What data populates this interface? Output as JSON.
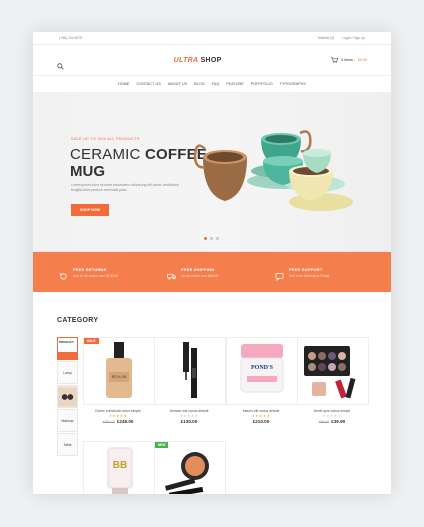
{
  "topbar": {
    "phone": "(+88) 234 5678",
    "wishlist": "Wishlist (0)",
    "login": "Login / Sign up"
  },
  "header": {
    "logo_a": "ULTRA",
    "logo_b": "SHOP",
    "cart_label": "0 items -",
    "cart_total": "£0.00"
  },
  "nav": [
    "HOME",
    "CONTACT US",
    "ABOUT US",
    "BLOG",
    "FAQ",
    "FEATURE",
    "PORTFOLIO",
    "TYPOGRAPHY"
  ],
  "hero": {
    "promo": "SALE UP TO 30% ALL PRODUCTS",
    "title_light": "CERAMIC ",
    "title_bold": "COFFEE",
    "title_line2": "MUG",
    "desc": "Lorem ipsum dolor sit amet consectetur adipiscing elit donec vestibulum fringilla tortor pretium venenatis justo.",
    "button": "SHOP NOW"
  },
  "features": [
    {
      "title": "FREE RETURNS",
      "sub": "Any for all orders over $100.00",
      "icon": "returns-icon"
    },
    {
      "title": "FREE SHIPPING",
      "sub": "On all orders over $45.00",
      "icon": "shipping-icon"
    },
    {
      "title": "FREE SUPPORT",
      "sub": "24/7 from Monday to Friday",
      "icon": "support-icon"
    }
  ],
  "category": {
    "title": "CATEGORY",
    "side": [
      "PRODUCT",
      "Lamp",
      "",
      "Makeup",
      "Table"
    ]
  },
  "products": [
    {
      "name": "Donec sollicitudin dolor simple",
      "old": "£300.00",
      "price": "£249.00",
      "stars": "★★★★★",
      "rated": true,
      "badge": "SALE"
    },
    {
      "name": "Aenean nisl varius default",
      "old": "",
      "price": "£130.00",
      "stars": "★★★★★",
      "rated": false,
      "badge": ""
    },
    {
      "name": "Mauris elit varius default",
      "old": "",
      "price": "£210.00",
      "stars": "★★★★★",
      "rated": true,
      "badge": ""
    },
    {
      "name": "Aenei quis varius simple",
      "old": "£55.00",
      "price": "£39.90",
      "stars": "★★★★★",
      "rated": false,
      "badge": ""
    },
    {
      "name": "",
      "old": "",
      "price": "",
      "stars": "",
      "rated": false,
      "badge": ""
    },
    {
      "name": "",
      "old": "",
      "price": "",
      "stars": "",
      "rated": false,
      "badge": "NEW"
    }
  ],
  "colors": {
    "accent": "#f26b3a",
    "feature_band": "#f57f4c"
  }
}
